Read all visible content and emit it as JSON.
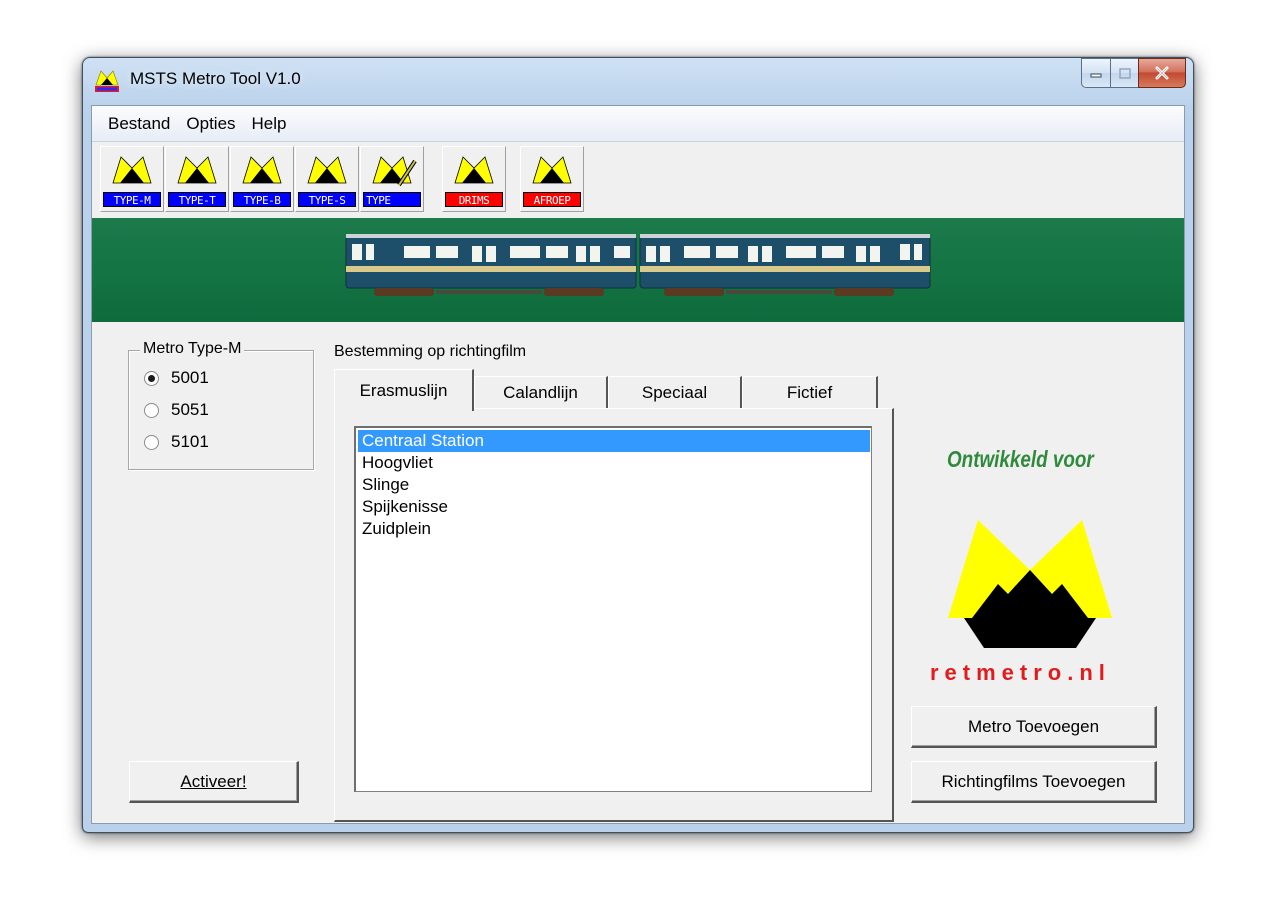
{
  "window": {
    "title": "MSTS Metro Tool V1.0"
  },
  "menu": [
    "Bestand",
    "Opties",
    "Help"
  ],
  "toolbar": [
    {
      "label": "TYPE-M",
      "color": "#0000ff"
    },
    {
      "label": "TYPE-T",
      "color": "#0000ff"
    },
    {
      "label": "TYPE-B",
      "color": "#0000ff"
    },
    {
      "label": "TYPE-S",
      "color": "#0000ff"
    },
    {
      "label": "TYPE",
      "color": "#0000ff"
    },
    {
      "label": "DRIMS",
      "color": "#ff0000"
    },
    {
      "label": "AFROEP",
      "color": "#ff0000"
    }
  ],
  "group": {
    "legend": "Metro Type-M",
    "options": [
      {
        "label": "5001",
        "checked": true
      },
      {
        "label": "5051",
        "checked": false
      },
      {
        "label": "5101",
        "checked": false
      }
    ]
  },
  "activate_label": "Activeer!",
  "tabs_caption": "Bestemming op richtingfilm",
  "tabs": [
    {
      "label": "Erasmuslijn",
      "active": true
    },
    {
      "label": "Calandlijn",
      "active": false
    },
    {
      "label": "Speciaal",
      "active": false
    },
    {
      "label": "Fictief",
      "active": false
    }
  ],
  "destinations": [
    {
      "label": "Centraal Station",
      "selected": true
    },
    {
      "label": "Hoogvliet",
      "selected": false
    },
    {
      "label": "Slinge",
      "selected": false
    },
    {
      "label": "Spijkenisse",
      "selected": false
    },
    {
      "label": "Zuidplein",
      "selected": false
    }
  ],
  "developed_for": "Ontwikkeld voor",
  "logo_text": "retmetro.nl",
  "buttons": {
    "add_metro": "Metro Toevoegen",
    "add_films": "Richtingfilms Toevoegen"
  },
  "colors": {
    "banner": "#137342",
    "logo_yellow": "#ffff00",
    "logo_red": "#e01c1c",
    "selection": "#3399ff"
  }
}
